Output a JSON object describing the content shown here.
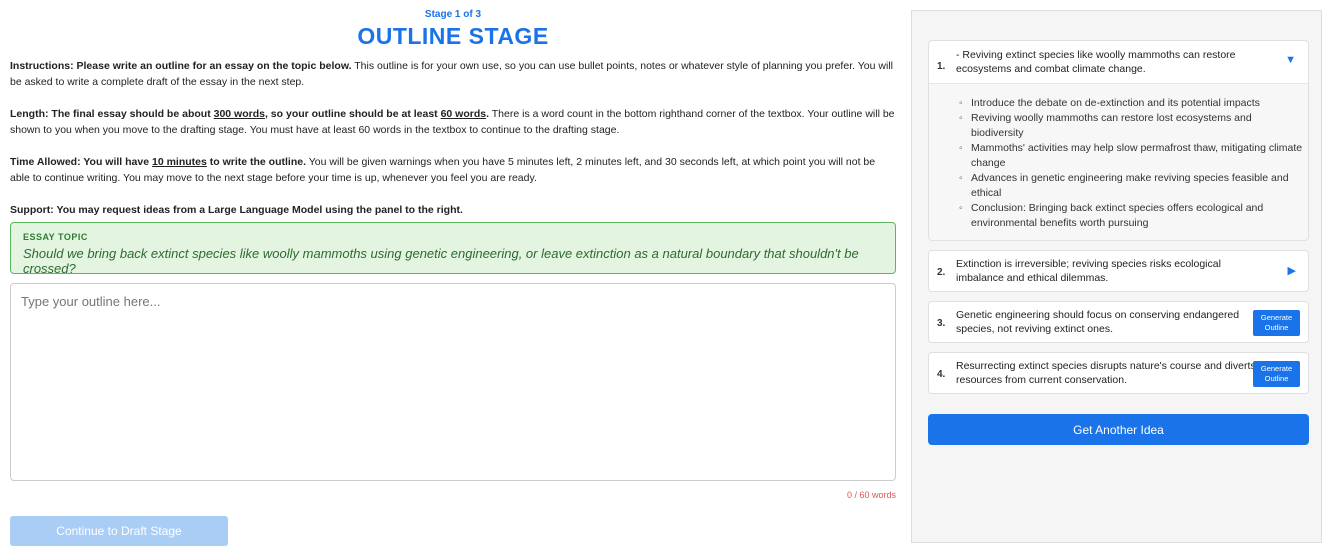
{
  "header": {
    "stage_label": "Stage 1 of 3",
    "title": "OUTLINE STAGE"
  },
  "instructions": {
    "p1_bold": "Instructions: Please write an outline for an essay on the topic below.",
    "p1_rest": " This outline is for your own use, so you can use bullet points, notes or whatever style of planning you prefer. You will be asked to write a complete draft of the essay in the next step.",
    "p2_bold_a": "Length: The final essay should be about ",
    "p2_u1": "300 words",
    "p2_bold_b": ", so your outline should be at least ",
    "p2_u2": "60 words",
    "p2_bold_c": ".",
    "p2_rest": " There is a word count in the bottom righthand corner of the textbox. Your outline will be shown to you when you move to the drafting stage. You must have at least 60 words in the textbox to continue to the drafting stage.",
    "p3_bold_a": "Time Allowed: You will have ",
    "p3_u1": "10 minutes",
    "p3_bold_b": " to write the outline.",
    "p3_rest": " You will be given warnings when you have 5 minutes left, 2 minutes left, and 30 seconds left, at which point you will not be able to continue writing. You may move to the next stage before your time is up, whenever you feel you are ready.",
    "p4": "Support: You may request ideas from a Large Language Model using the panel to the right."
  },
  "topic": {
    "label": "ESSAY TOPIC",
    "text": "Should we bring back extinct species like woolly mammoths using genetic engineering, or leave extinction as a natural boundary that shouldn't be crossed?"
  },
  "editor": {
    "placeholder": "Type your outline here...",
    "value": "",
    "word_count": "0 / 60 words"
  },
  "continue_button": "Continue to Draft Stage",
  "sidebar": {
    "ideas": [
      {
        "num": "1.",
        "text": "- Reviving extinct species like woolly mammoths can restore ecosystems and combat climate change.",
        "expanded": true,
        "bullets": [
          "Introduce the debate on de-extinction and its potential impacts",
          "Reviving woolly mammoths can restore lost ecosystems and biodiversity",
          "Mammoths' activities may help slow permafrost thaw, mitigating climate change",
          "Advances in genetic engineering make reviving species feasible and ethical",
          "Conclusion: Bringing back extinct species offers ecological and environmental benefits worth pursuing"
        ]
      },
      {
        "num": "2.",
        "text": "Extinction is irreversible; reviving species risks ecological imbalance and ethical dilemmas.",
        "expanded": false
      },
      {
        "num": "3.",
        "text": "Genetic engineering should focus on conserving endangered species, not reviving extinct ones.",
        "button": "Generate Outline"
      },
      {
        "num": "4.",
        "text": "Resurrecting extinct species disrupts nature's course and diverts resources from current conservation.",
        "button": "Generate Outline"
      }
    ],
    "another_button": "Get Another Idea"
  },
  "colors": {
    "accent": "#1a73e8",
    "topic_bg": "#e3f4e0",
    "topic_border": "#5cb85c",
    "warning": "#e05555",
    "disabled_button": "#a9cdf5"
  },
  "icons": {
    "expanded": "triangle-down-icon",
    "collapsed": "triangle-right-icon"
  }
}
